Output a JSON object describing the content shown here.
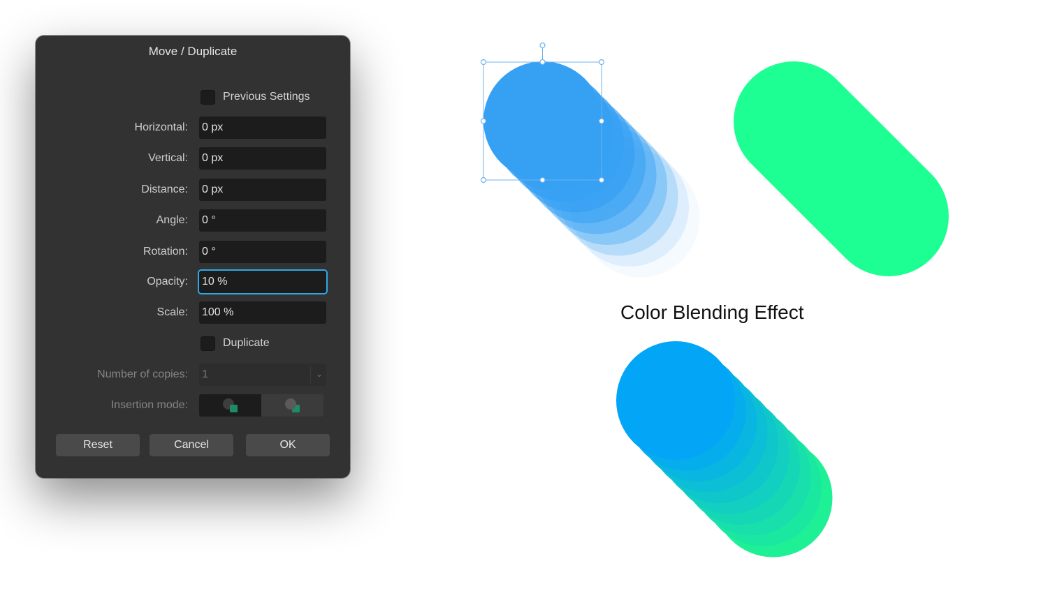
{
  "dialog": {
    "title": "Move / Duplicate",
    "previous_settings_label": "Previous Settings",
    "fields": {
      "horizontal": {
        "label": "Horizontal:",
        "value": "0 px"
      },
      "vertical": {
        "label": "Vertical:",
        "value": "0 px"
      },
      "distance": {
        "label": "Distance:",
        "value": "0 px"
      },
      "angle": {
        "label": "Angle:",
        "value": "0 °"
      },
      "rotation": {
        "label": "Rotation:",
        "value": "0 °"
      },
      "opacity": {
        "label": "Opacity:",
        "value": "10 %"
      },
      "scale": {
        "label": "Scale:",
        "value": "100 %"
      }
    },
    "duplicate_label": "Duplicate",
    "copies": {
      "label": "Number of copies:",
      "value": "1"
    },
    "insertion_mode": {
      "label": "Insertion mode:"
    },
    "buttons": {
      "reset": "Reset",
      "cancel": "Cancel",
      "ok": "OK"
    }
  },
  "canvas": {
    "caption": "Color Blending Effect",
    "colors": {
      "blue": "#36a0f3",
      "green": "#1dfe93",
      "gradient_start": "#03a5f7",
      "gradient_end": "#1ef095",
      "selection": "#6fb1ee"
    }
  }
}
